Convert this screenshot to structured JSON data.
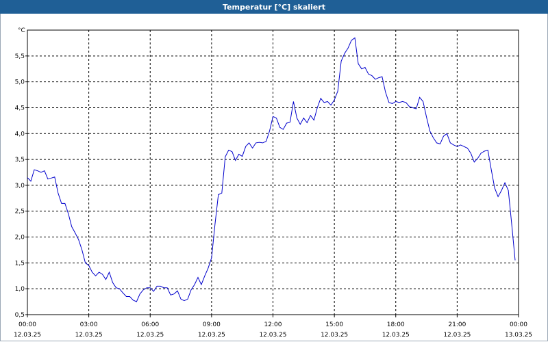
{
  "window": {
    "title": "Temperatur [°C] skaliert"
  },
  "chart_data": {
    "type": "line",
    "title": "Temperatur [°C] skaliert",
    "ylabel": "°C",
    "xlabel": "",
    "ylim": [
      0.5,
      6.0
    ],
    "y_ticks": [
      "0,5",
      "1,0",
      "1,5",
      "2,0",
      "2,5",
      "3,0",
      "3,5",
      "4,0",
      "4,5",
      "5,0",
      "5,5"
    ],
    "y_tick_values": [
      0.5,
      1.0,
      1.5,
      2.0,
      2.5,
      3.0,
      3.5,
      4.0,
      4.5,
      5.0,
      5.5
    ],
    "x_ticks": [
      {
        "time": "00:00",
        "date": "12.03.25"
      },
      {
        "time": "03:00",
        "date": "12.03.25"
      },
      {
        "time": "06:00",
        "date": "12.03.25"
      },
      {
        "time": "09:00",
        "date": "12.03.25"
      },
      {
        "time": "12:00",
        "date": "12.03.25"
      },
      {
        "time": "15:00",
        "date": "12.03.25"
      },
      {
        "time": "18:00",
        "date": "12.03.25"
      },
      {
        "time": "21:00",
        "date": "12.03.25"
      },
      {
        "time": "00:00",
        "date": "13.03.25"
      }
    ],
    "grid": true,
    "line_color": "#0000cc",
    "series": [
      {
        "x": [
          "12.03.25 00:00",
          "12.03.25 00:10",
          "12.03.25 00:20",
          "12.03.25 00:30",
          "12.03.25 00:40",
          "12.03.25 00:50",
          "12.03.25 01:00",
          "12.03.25 01:10",
          "12.03.25 01:20",
          "12.03.25 01:30",
          "12.03.25 01:40",
          "12.03.25 01:50",
          "12.03.25 02:00",
          "12.03.25 02:10",
          "12.03.25 02:20",
          "12.03.25 02:30",
          "12.03.25 02:40",
          "12.03.25 02:50",
          "12.03.25 03:00",
          "12.03.25 03:10",
          "12.03.25 03:20",
          "12.03.25 03:30",
          "12.03.25 03:40",
          "12.03.25 03:50",
          "12.03.25 04:00",
          "12.03.25 04:10",
          "12.03.25 04:20",
          "12.03.25 04:30",
          "12.03.25 04:40",
          "12.03.25 04:50",
          "12.03.25 05:00",
          "12.03.25 05:10",
          "12.03.25 05:20",
          "12.03.25 05:30",
          "12.03.25 05:40",
          "12.03.25 05:50",
          "12.03.25 06:00",
          "12.03.25 06:10",
          "12.03.25 06:20",
          "12.03.25 06:30",
          "12.03.25 06:40",
          "12.03.25 06:50",
          "12.03.25 07:00",
          "12.03.25 07:10",
          "12.03.25 07:20",
          "12.03.25 07:30",
          "12.03.25 07:40",
          "12.03.25 07:50",
          "12.03.25 08:00",
          "12.03.25 08:10",
          "12.03.25 08:20",
          "12.03.25 08:30",
          "12.03.25 08:40",
          "12.03.25 08:50",
          "12.03.25 09:00",
          "12.03.25 09:10",
          "12.03.25 09:20",
          "12.03.25 09:30",
          "12.03.25 09:40",
          "12.03.25 09:50",
          "12.03.25 10:00",
          "12.03.25 10:10",
          "12.03.25 10:20",
          "12.03.25 10:30",
          "12.03.25 10:40",
          "12.03.25 10:50",
          "12.03.25 11:00",
          "12.03.25 11:10",
          "12.03.25 11:20",
          "12.03.25 11:30",
          "12.03.25 11:40",
          "12.03.25 11:50",
          "12.03.25 12:00",
          "12.03.25 12:10",
          "12.03.25 12:20",
          "12.03.25 12:30",
          "12.03.25 12:40",
          "12.03.25 12:50",
          "12.03.25 13:00",
          "12.03.25 13:10",
          "12.03.25 13:20",
          "12.03.25 13:30",
          "12.03.25 13:40",
          "12.03.25 13:50",
          "12.03.25 14:00",
          "12.03.25 14:10",
          "12.03.25 14:20",
          "12.03.25 14:30",
          "12.03.25 14:40",
          "12.03.25 14:50",
          "12.03.25 15:00",
          "12.03.25 15:10",
          "12.03.25 15:20",
          "12.03.25 15:30",
          "12.03.25 15:40",
          "12.03.25 15:50",
          "12.03.25 16:00",
          "12.03.25 16:10",
          "12.03.25 16:20",
          "12.03.25 16:30",
          "12.03.25 16:40",
          "12.03.25 16:50",
          "12.03.25 17:00",
          "12.03.25 17:10",
          "12.03.25 17:20",
          "12.03.25 17:30",
          "12.03.25 17:40",
          "12.03.25 17:50",
          "12.03.25 18:00",
          "12.03.25 18:10",
          "12.03.25 18:20",
          "12.03.25 18:30",
          "12.03.25 18:40",
          "12.03.25 18:50",
          "12.03.25 19:00",
          "12.03.25 19:10",
          "12.03.25 19:20",
          "12.03.25 19:30",
          "12.03.25 19:40",
          "12.03.25 19:50",
          "12.03.25 20:00",
          "12.03.25 20:10",
          "12.03.25 20:20",
          "12.03.25 20:30",
          "12.03.25 20:40",
          "12.03.25 20:50",
          "12.03.25 21:00",
          "12.03.25 21:10",
          "12.03.25 21:20",
          "12.03.25 21:30",
          "12.03.25 21:40",
          "12.03.25 21:50",
          "12.03.25 22:00",
          "12.03.25 22:10",
          "12.03.25 22:20",
          "12.03.25 22:30",
          "12.03.25 22:40",
          "12.03.25 22:50",
          "12.03.25 23:00",
          "12.03.25 23:10",
          "12.03.25 23:20",
          "12.03.25 23:30",
          "12.03.25 23:40",
          "12.03.25 23:50"
        ],
        "y": [
          3.15,
          3.08,
          3.3,
          3.28,
          3.25,
          3.28,
          3.12,
          3.14,
          3.16,
          2.85,
          2.65,
          2.65,
          2.45,
          2.2,
          2.08,
          1.95,
          1.75,
          1.5,
          1.45,
          1.32,
          1.25,
          1.32,
          1.28,
          1.18,
          1.32,
          1.12,
          1.02,
          1.0,
          0.92,
          0.85,
          0.85,
          0.78,
          0.75,
          0.9,
          0.98,
          1.02,
          1.02,
          0.95,
          1.05,
          1.05,
          1.02,
          1.02,
          0.88,
          0.9,
          0.96,
          0.8,
          0.77,
          0.8,
          0.98,
          1.08,
          1.22,
          1.08,
          1.25,
          1.4,
          1.6,
          2.25,
          2.82,
          2.85,
          3.55,
          3.68,
          3.65,
          3.48,
          3.6,
          3.56,
          3.75,
          3.82,
          3.72,
          3.82,
          3.83,
          3.82,
          3.85,
          4.05,
          4.33,
          4.3,
          4.12,
          4.08,
          4.2,
          4.22,
          4.62,
          4.3,
          4.18,
          4.3,
          4.21,
          4.35,
          4.26,
          4.5,
          4.68,
          4.6,
          4.62,
          4.55,
          4.65,
          4.82,
          5.4,
          5.55,
          5.65,
          5.8,
          5.85,
          5.35,
          5.25,
          5.28,
          5.15,
          5.12,
          5.05,
          5.08,
          5.1,
          4.8,
          4.6,
          4.58,
          4.62,
          4.6,
          4.62,
          4.6,
          4.52,
          4.5,
          4.48,
          4.7,
          4.62,
          4.32,
          4.05,
          3.92,
          3.82,
          3.8,
          3.95,
          4.0,
          3.82,
          3.78,
          3.75,
          3.78,
          3.75,
          3.72,
          3.62,
          3.45,
          3.52,
          3.62,
          3.66,
          3.68,
          3.3,
          2.95,
          2.78,
          2.9,
          3.05,
          2.9,
          2.25,
          1.55
        ]
      }
    ]
  }
}
